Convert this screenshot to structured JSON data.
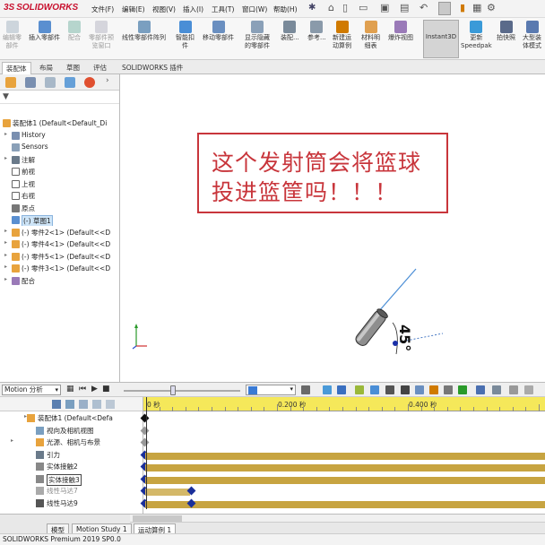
{
  "app": {
    "logo_text": "SOLIDWORKS"
  },
  "menubar": {
    "items": [
      "文件(F)",
      "编辑(E)",
      "视图(V)",
      "插入(I)",
      "工具(T)",
      "窗口(W)",
      "帮助(H)"
    ]
  },
  "ribbon": {
    "buttons": [
      {
        "label": "编辑零\n部件",
        "disabled": true
      },
      {
        "label": "插入零部件",
        "disabled": false
      },
      {
        "label": "配合",
        "disabled": true
      },
      {
        "label": "零部件预\n览窗口",
        "disabled": true
      },
      {
        "label": "线性零部件阵列",
        "disabled": false
      },
      {
        "label": "智能扣\n件",
        "disabled": false
      },
      {
        "label": "移动零部件",
        "disabled": false
      },
      {
        "label": "显示隐藏\n的零部件",
        "disabled": false
      },
      {
        "label": "装配...",
        "disabled": false
      },
      {
        "label": "参考...",
        "disabled": false
      },
      {
        "label": "新建运\n动算例",
        "disabled": false
      },
      {
        "label": "材料明\n细表",
        "disabled": false
      },
      {
        "label": "爆炸视图",
        "disabled": false
      },
      {
        "label": "Instant3D",
        "disabled": false
      },
      {
        "label": "更新\nSpeedpak",
        "disabled": false
      },
      {
        "label": "拍快照",
        "disabled": false
      },
      {
        "label": "大型装\n体模式",
        "disabled": false
      }
    ]
  },
  "command_tabs": [
    "装配体",
    "布局",
    "草图",
    "评估",
    "SOLIDWORKS 插件"
  ],
  "feature_tree": [
    {
      "label": "装配体1  (Default<Default_Di",
      "twisty": ""
    },
    {
      "label": "History",
      "twisty": "▸"
    },
    {
      "label": "Sensors",
      "twisty": ""
    },
    {
      "label": "注解",
      "twisty": "▸"
    },
    {
      "label": "前视",
      "twisty": ""
    },
    {
      "label": "上视",
      "twisty": ""
    },
    {
      "label": "右视",
      "twisty": ""
    },
    {
      "label": "原点",
      "twisty": ""
    },
    {
      "label": "(-) 草图1",
      "twisty": ""
    },
    {
      "label": "(-) 零件2<1> (Default<<D",
      "twisty": "▸"
    },
    {
      "label": "(-) 零件4<1> (Default<<D",
      "twisty": "▸"
    },
    {
      "label": "(-) 零件5<1> (Default<<D",
      "twisty": "▸"
    },
    {
      "label": "(-) 零件3<1> (Default<<D",
      "twisty": "▸"
    },
    {
      "label": "配合",
      "twisty": "▸"
    }
  ],
  "callout": {
    "line1": "这个发射筒会将篮球",
    "line2": "投进篮筐吗！！！"
  },
  "model": {
    "angle_label": "45°"
  },
  "motion": {
    "analysis_type": "Motion 分析",
    "timeline_labels": [
      "0 秒",
      "0.200 秒",
      "0.400 秒"
    ],
    "tree": [
      {
        "label": "装配体1  (Default<Defa",
        "gray": false
      },
      {
        "label": "视向及相机视图",
        "gray": false
      },
      {
        "label": "光源、相机与布景",
        "gray": false
      },
      {
        "label": "引力",
        "gray": false
      },
      {
        "label": "实体接触2",
        "gray": false
      },
      {
        "label": "实体接触3",
        "gray": false
      },
      {
        "label": "线性马达7",
        "gray": true
      },
      {
        "label": "线性马达9",
        "gray": false
      }
    ]
  },
  "bottom_tabs": [
    "模型",
    "Motion Study 1",
    "运动算例 1"
  ],
  "status": {
    "text": "SOLIDWORKS Premium 2019 SP0.0"
  },
  "colors": {
    "accent_red": "#c8353b",
    "timeline_header": "#f5e85a",
    "track_bar": "#c7a441",
    "key_blue": "#1a2f9a"
  }
}
